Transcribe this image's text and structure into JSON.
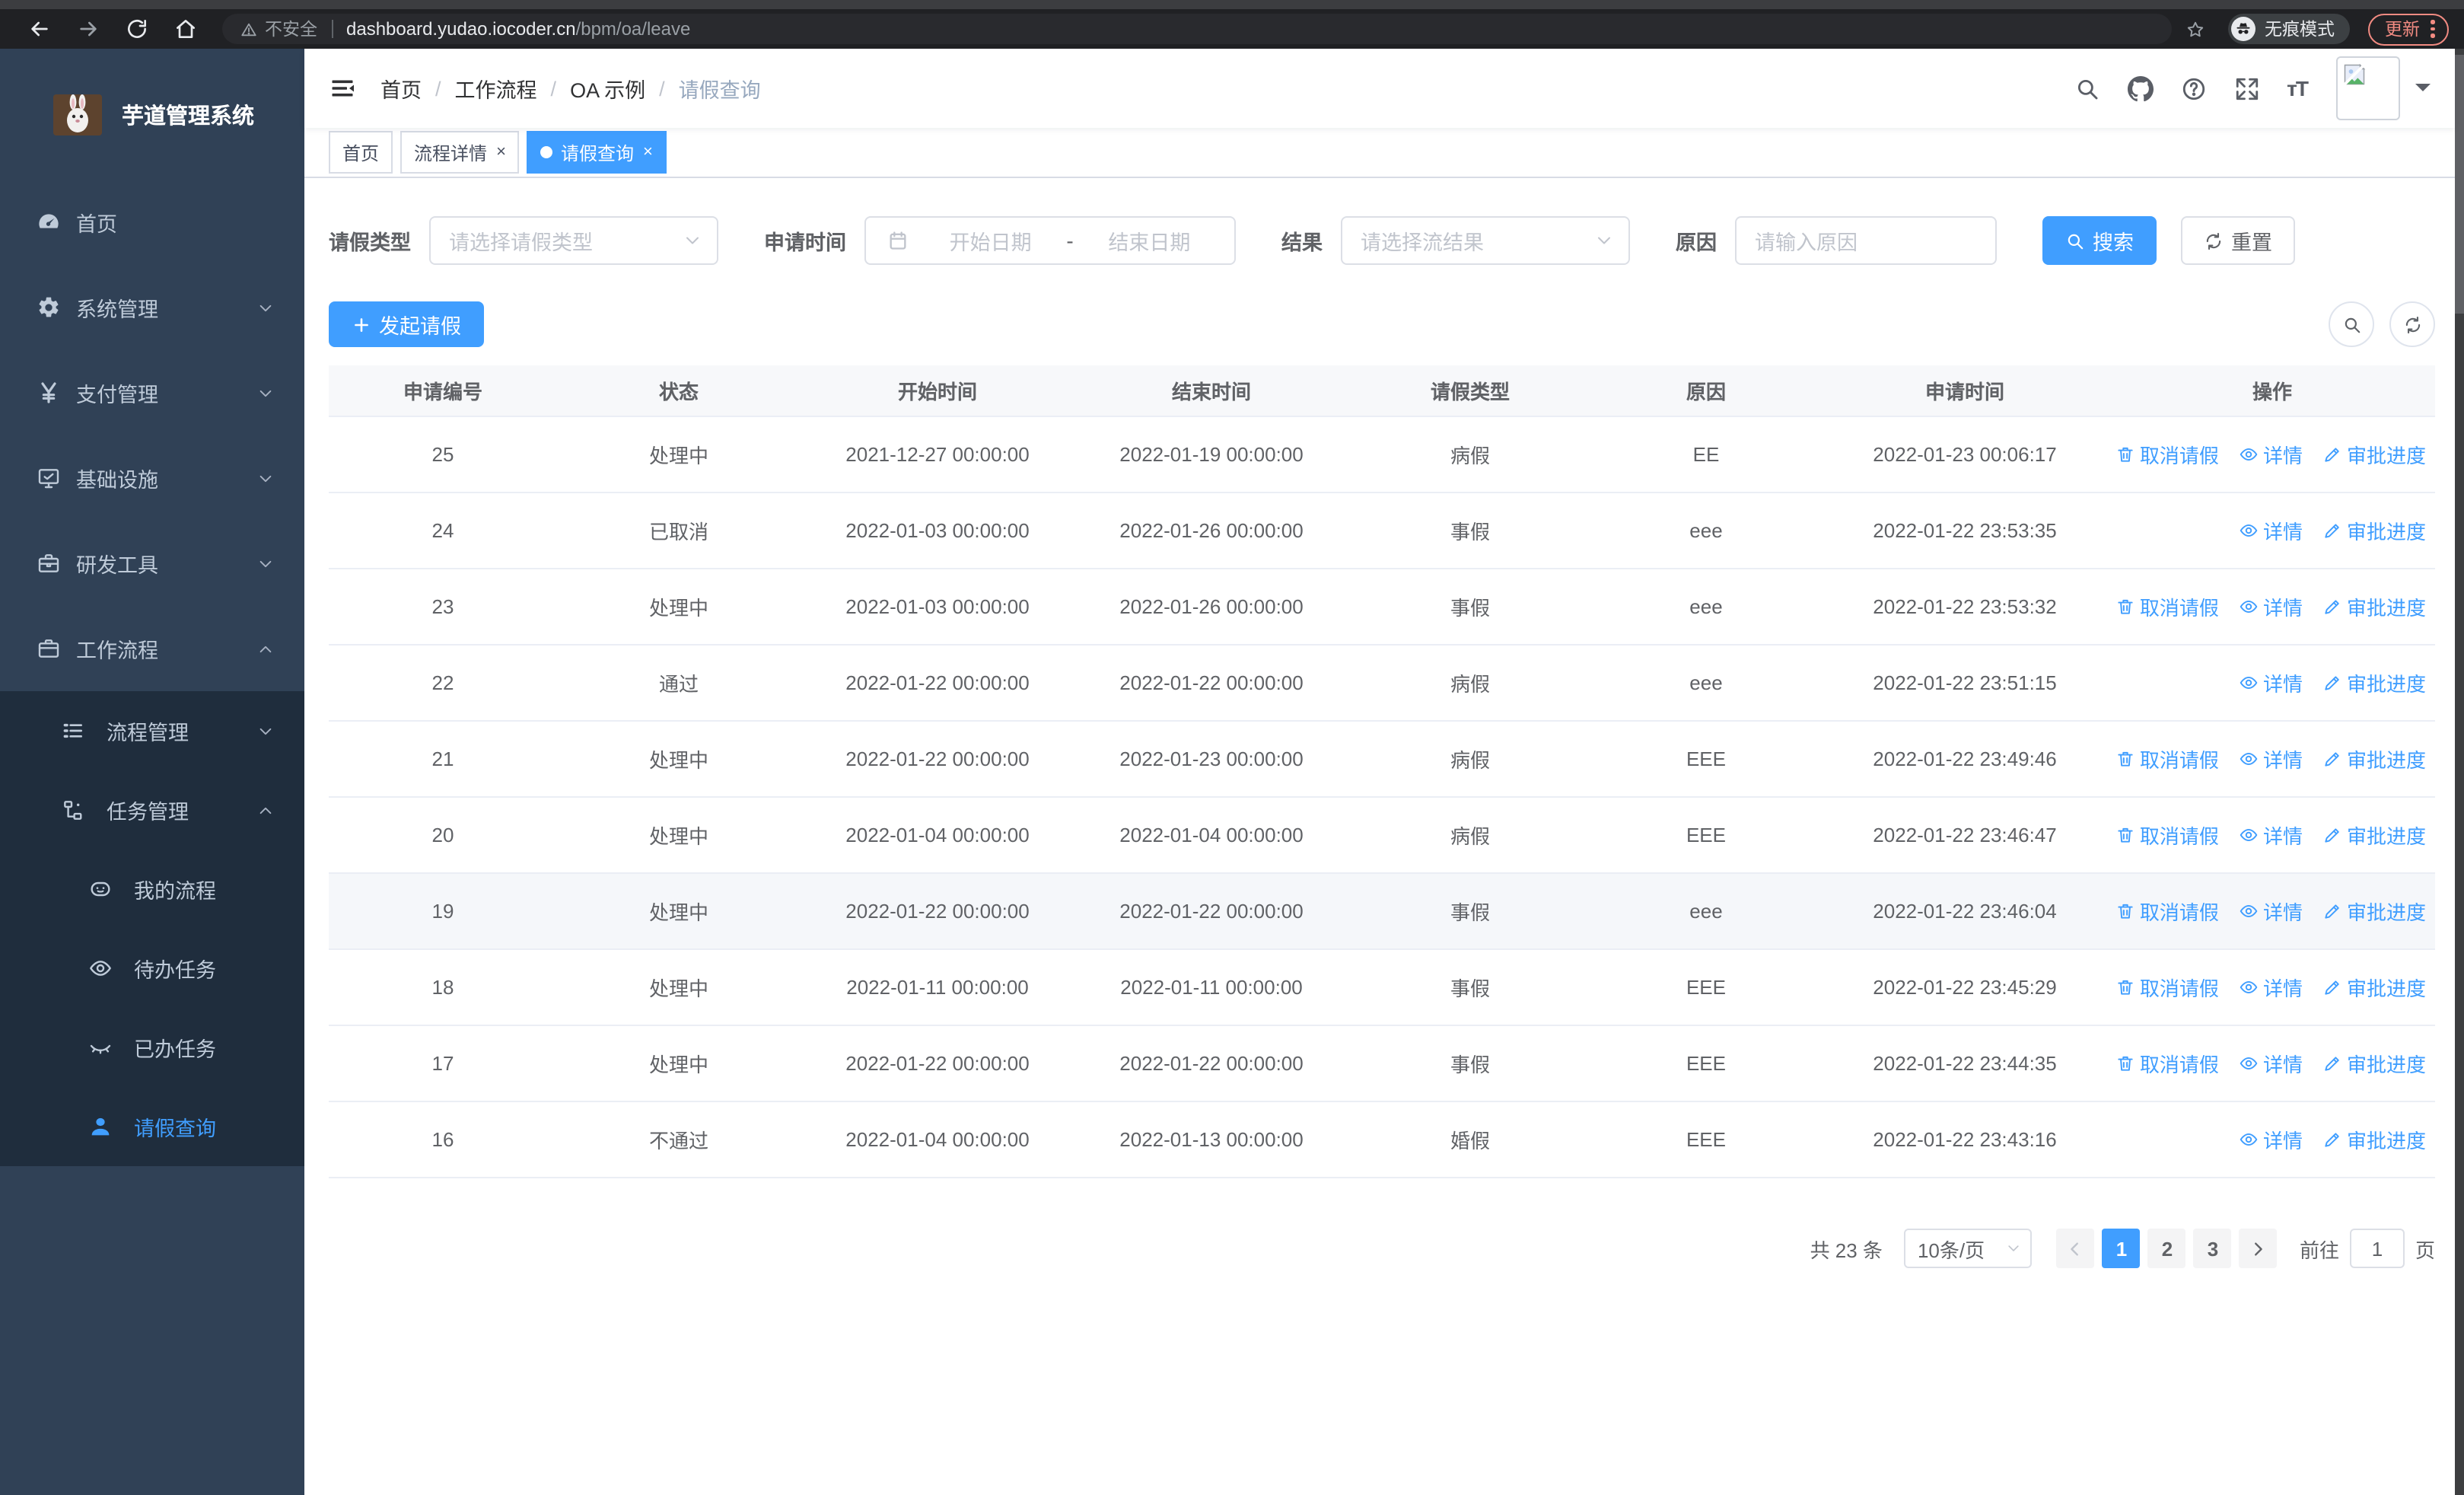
{
  "browser": {
    "security_label": "不安全",
    "url_host": "dashboard.yudao.iocoder.cn",
    "url_path": "/bpm/oa/leave",
    "incognito_label": "无痕模式",
    "update_label": "更新",
    "accent_color": "#f28b82"
  },
  "sidebar": {
    "title": "芋道管理系统",
    "colors": {
      "bg": "#304156",
      "submenu_bg": "#1f2d3d",
      "text": "#bfcbd9",
      "active": "#409eff"
    },
    "items": [
      {
        "label": "首页",
        "icon": "dashboard-icon"
      },
      {
        "label": "系统管理",
        "icon": "gear-icon",
        "arrow": "down"
      },
      {
        "label": "支付管理",
        "icon": "yen-icon",
        "arrow": "down"
      },
      {
        "label": "基础设施",
        "icon": "monitor-icon",
        "arrow": "down"
      },
      {
        "label": "研发工具",
        "icon": "toolbox-icon",
        "arrow": "down"
      },
      {
        "label": "工作流程",
        "icon": "briefcase-icon",
        "arrow": "up"
      },
      {
        "label": "流程管理",
        "icon": "flow-list-icon",
        "arrow": "down"
      },
      {
        "label": "任务管理",
        "icon": "tree-icon",
        "arrow": "up"
      },
      {
        "label": "我的流程",
        "icon": "face-icon"
      },
      {
        "label": "待办任务",
        "icon": "eye-icon"
      },
      {
        "label": "已办任务",
        "icon": "eye-closed-icon"
      },
      {
        "label": "请假查询",
        "icon": "user-icon",
        "active": true
      }
    ]
  },
  "breadcrumb": {
    "items": [
      "首页",
      "工作流程",
      "OA 示例",
      "请假查询"
    ]
  },
  "tabs": [
    {
      "label": "首页",
      "closable": false,
      "active": false
    },
    {
      "label": "流程详情",
      "closable": true,
      "active": false
    },
    {
      "label": "请假查询",
      "closable": true,
      "active": true
    }
  ],
  "filters": {
    "leave_type": {
      "label": "请假类型",
      "placeholder": "请选择请假类型"
    },
    "apply_time": {
      "label": "申请时间",
      "start_placeholder": "开始日期",
      "separator": "-",
      "end_placeholder": "结束日期"
    },
    "result": {
      "label": "结果",
      "placeholder": "请选择流结果"
    },
    "reason": {
      "label": "原因",
      "placeholder": "请输入原因"
    },
    "search_label": "搜索",
    "reset_label": "重置"
  },
  "toolbar": {
    "create_label": "发起请假"
  },
  "table": {
    "accent_color": "#409eff",
    "columns": [
      "申请编号",
      "状态",
      "开始时间",
      "结束时间",
      "请假类型",
      "原因",
      "申请时间",
      "操作"
    ],
    "actions": {
      "cancel": {
        "label": "取消请假",
        "icon": "trash-icon"
      },
      "detail": {
        "label": "详情",
        "icon": "eye-icon"
      },
      "progress": {
        "label": "审批进度",
        "icon": "pen-icon"
      }
    },
    "rows": [
      {
        "id": "25",
        "status": "处理中",
        "start": "2021-12-27 00:00:00",
        "end": "2022-01-19 00:00:00",
        "type": "病假",
        "reason": "EE",
        "apply_time": "2022-01-23 00:06:17",
        "actions": [
          "cancel",
          "detail",
          "progress"
        ]
      },
      {
        "id": "24",
        "status": "已取消",
        "start": "2022-01-03 00:00:00",
        "end": "2022-01-26 00:00:00",
        "type": "事假",
        "reason": "eee",
        "apply_time": "2022-01-22 23:53:35",
        "actions": [
          "detail",
          "progress"
        ]
      },
      {
        "id": "23",
        "status": "处理中",
        "start": "2022-01-03 00:00:00",
        "end": "2022-01-26 00:00:00",
        "type": "事假",
        "reason": "eee",
        "apply_time": "2022-01-22 23:53:32",
        "actions": [
          "cancel",
          "detail",
          "progress"
        ]
      },
      {
        "id": "22",
        "status": "通过",
        "start": "2022-01-22 00:00:00",
        "end": "2022-01-22 00:00:00",
        "type": "病假",
        "reason": "eee",
        "apply_time": "2022-01-22 23:51:15",
        "actions": [
          "detail",
          "progress"
        ]
      },
      {
        "id": "21",
        "status": "处理中",
        "start": "2022-01-22 00:00:00",
        "end": "2022-01-23 00:00:00",
        "type": "病假",
        "reason": "EEE",
        "apply_time": "2022-01-22 23:49:46",
        "actions": [
          "cancel",
          "detail",
          "progress"
        ]
      },
      {
        "id": "20",
        "status": "处理中",
        "start": "2022-01-04 00:00:00",
        "end": "2022-01-04 00:00:00",
        "type": "病假",
        "reason": "EEE",
        "apply_time": "2022-01-22 23:46:47",
        "actions": [
          "cancel",
          "detail",
          "progress"
        ]
      },
      {
        "id": "19",
        "status": "处理中",
        "start": "2022-01-22 00:00:00",
        "end": "2022-01-22 00:00:00",
        "type": "事假",
        "reason": "eee",
        "apply_time": "2022-01-22 23:46:04",
        "actions": [
          "cancel",
          "detail",
          "progress"
        ],
        "highlight": true
      },
      {
        "id": "18",
        "status": "处理中",
        "start": "2022-01-11 00:00:00",
        "end": "2022-01-11 00:00:00",
        "type": "事假",
        "reason": "EEE",
        "apply_time": "2022-01-22 23:45:29",
        "actions": [
          "cancel",
          "detail",
          "progress"
        ]
      },
      {
        "id": "17",
        "status": "处理中",
        "start": "2022-01-22 00:00:00",
        "end": "2022-01-22 00:00:00",
        "type": "事假",
        "reason": "EEE",
        "apply_time": "2022-01-22 23:44:35",
        "actions": [
          "cancel",
          "detail",
          "progress"
        ]
      },
      {
        "id": "16",
        "status": "不通过",
        "start": "2022-01-04 00:00:00",
        "end": "2022-01-13 00:00:00",
        "type": "婚假",
        "reason": "EEE",
        "apply_time": "2022-01-22 23:43:16",
        "actions": [
          "detail",
          "progress"
        ]
      }
    ]
  },
  "pagination": {
    "total_label": "共 23 条",
    "page_size_label": "10条/页",
    "pages": [
      "1",
      "2",
      "3"
    ],
    "active_page": "1",
    "goto_label": "前往",
    "goto_value": "1",
    "page_unit_label": "页"
  }
}
